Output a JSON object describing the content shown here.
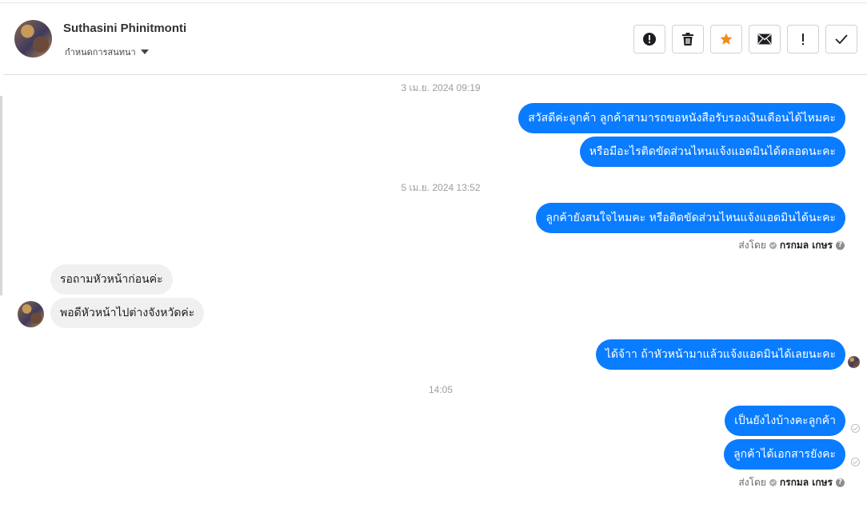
{
  "header": {
    "contact_name": "Suthasini Phinitmonti",
    "assign_label": "กำหนดการสนทนา",
    "actions": [
      {
        "name": "spam-button",
        "icon": "alert-circle-icon"
      },
      {
        "name": "delete-button",
        "icon": "trash-icon"
      },
      {
        "name": "star-button",
        "icon": "star-icon",
        "color": "#f28a1e"
      },
      {
        "name": "mark-unread-button",
        "icon": "envelope-icon"
      },
      {
        "name": "important-button",
        "icon": "exclamation-icon"
      },
      {
        "name": "done-button",
        "icon": "check-icon"
      }
    ]
  },
  "messages": {
    "ts1": "3 เม.ย. 2024 09:19",
    "m1": "สวัสดีค่ะลูกค้า ลูกค้าสามารถขอหนังสือรับรองเงินเดือนได้ไหมคะ",
    "m2": "หรือมีอะไรติดขัดส่วนไหนแจ้งแอดมินได้ตลอดนะคะ",
    "ts2": "5 เม.ย. 2024 13:52",
    "m3": "ลูกค้ายังสนใจไหมคะ หรือติดขัดส่วนไหนแจ้งแอดมินได้นะคะ",
    "sent_by_1": {
      "label": "ส่งโดย",
      "agent": "กรกมล เกษร"
    },
    "r1": "รอถามหัวหน้าก่อนค่ะ",
    "r2": "พอดีหัวหน้าไปต่างจังหวัดค่ะ",
    "m4": "ได้จ้าา ถ้าหัวหน้ามาแล้วแจ้งแอดมินได้เลยนะคะ",
    "ts3": "14:05",
    "m5": "เป็นยังไงบ้างคะลูกค้า",
    "m6": "ลูกค้าได้เอกสารยังคะ",
    "sent_by_2": {
      "label": "ส่งโดย",
      "agent": "กรกมล เกษร"
    }
  },
  "colors": {
    "outgoing_bubble": "#0a7cff",
    "incoming_bubble": "#f0f0f0",
    "star": "#f28a1e"
  }
}
